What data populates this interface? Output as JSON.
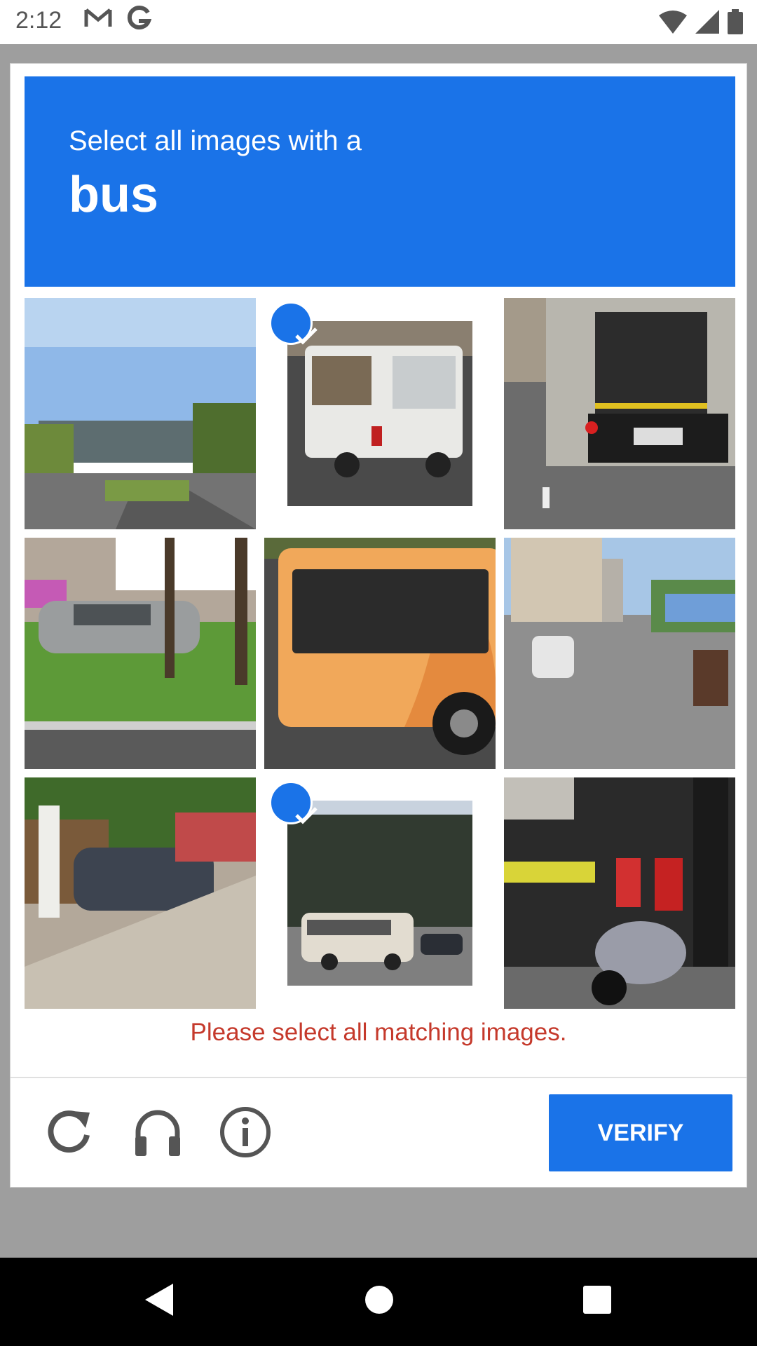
{
  "status_bar": {
    "time": "2:12",
    "icons": [
      "gmail-icon",
      "google-icon",
      "wifi-icon",
      "signal-icon",
      "battery-icon"
    ]
  },
  "captcha": {
    "instruction": "Select all images with a",
    "target": "bus",
    "tiles": [
      {
        "content": "road-with-building",
        "selected": false
      },
      {
        "content": "white-minibus",
        "selected": true
      },
      {
        "content": "truck-rear",
        "selected": false
      },
      {
        "content": "parked-cars-lawn",
        "selected": false
      },
      {
        "content": "orange-bus",
        "selected": false
      },
      {
        "content": "street-intersection",
        "selected": false
      },
      {
        "content": "car-by-gate",
        "selected": false
      },
      {
        "content": "white-minibus-trees",
        "selected": true
      },
      {
        "content": "shop-with-scooter",
        "selected": false
      }
    ],
    "error_message": "Please select all matching images.",
    "verify_label": "VERIFY"
  },
  "footer_icons": [
    "reload-icon",
    "headphones-icon",
    "info-icon"
  ],
  "navigation": [
    "back-icon",
    "home-icon",
    "recents-icon"
  ],
  "colors": {
    "accent": "#1a73e8",
    "error": "#c5392b"
  }
}
